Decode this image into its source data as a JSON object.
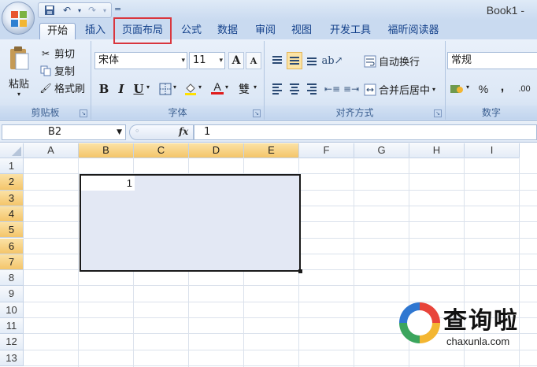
{
  "window": {
    "title": "Book1 -"
  },
  "quick_access": {
    "save_icon": "save-icon",
    "undo_icon": "undo-icon",
    "redo_icon": "redo-icon",
    "more": "="
  },
  "tabs": [
    {
      "label": "开始",
      "active": true
    },
    {
      "label": "插入"
    },
    {
      "label": "页面布局",
      "highlighted": true
    },
    {
      "label": "公式"
    },
    {
      "label": "数据"
    },
    {
      "label": "审阅"
    },
    {
      "label": "视图"
    },
    {
      "label": "开发工具"
    },
    {
      "label": "福昕阅读器"
    }
  ],
  "ribbon": {
    "clipboard": {
      "label": "剪贴板",
      "paste": "粘贴",
      "cut": "剪切",
      "copy": "复制",
      "format_painter": "格式刷"
    },
    "font": {
      "label": "字体",
      "font_name": "宋体",
      "font_size": "11",
      "grow": "A",
      "shrink": "A",
      "bold": "B",
      "italic": "I",
      "underline": "U",
      "font_color": "A",
      "phonetic": "雙"
    },
    "alignment": {
      "label": "对齐方式",
      "wrap_text": "自动换行",
      "merge_center": "合并后居中"
    },
    "number": {
      "label": "数字",
      "format": "常规",
      "percent": "%",
      "comma": ",",
      "decimal": ".00"
    }
  },
  "formula_bar": {
    "name_box": "B2",
    "fx": "fx",
    "value": "1"
  },
  "sheet": {
    "columns": [
      "A",
      "B",
      "C",
      "D",
      "E",
      "F",
      "G",
      "H",
      "I"
    ],
    "rows": [
      "1",
      "2",
      "3",
      "4",
      "5",
      "6",
      "7",
      "8",
      "9",
      "10",
      "11",
      "12",
      "13"
    ],
    "selected_columns": [
      "B",
      "C",
      "D",
      "E"
    ],
    "selected_rows": [
      "2",
      "3",
      "4",
      "5",
      "6",
      "7"
    ],
    "active_cell": {
      "ref": "B2",
      "value": "1"
    }
  },
  "watermark": {
    "text": "查询啦",
    "url": "chaxunla.com"
  },
  "colors": {
    "accent": "#15428b",
    "highlight_box": "#d9363e",
    "selected_header": "#f4c56a",
    "selection_fill": "#e3e8f4"
  }
}
